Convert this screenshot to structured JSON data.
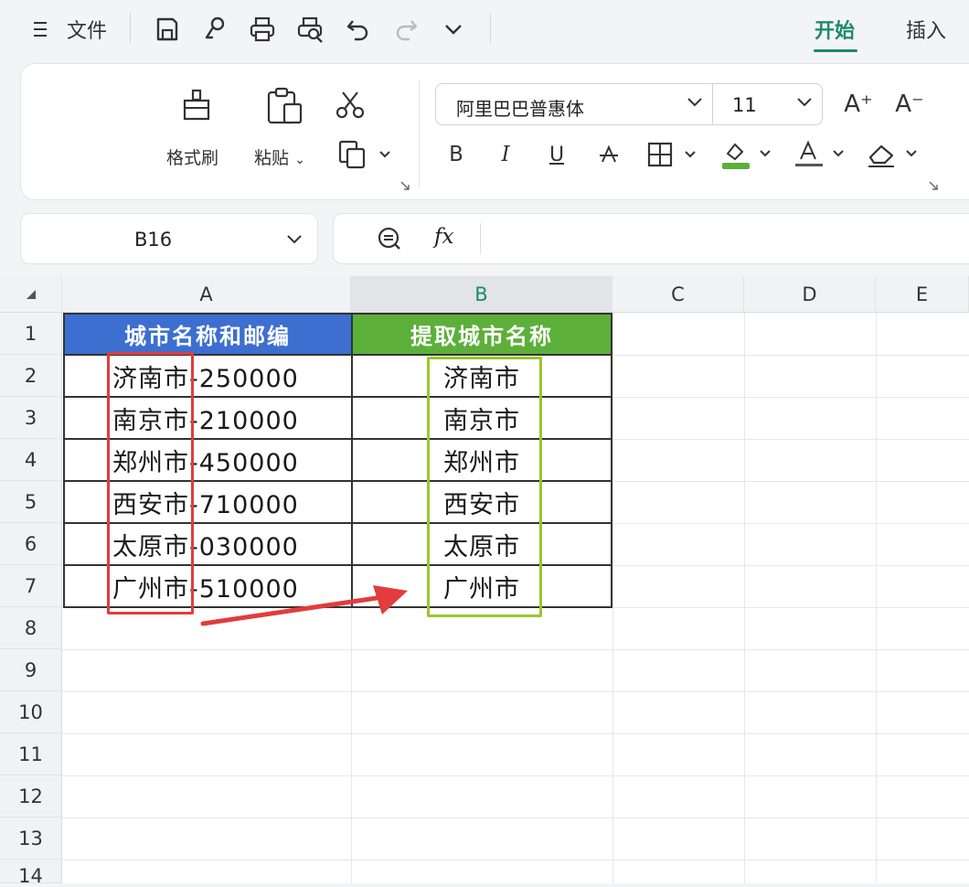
{
  "topbar": {
    "menu_icon": "hamburger-icon",
    "file_label": "文件",
    "tabs": [
      {
        "label": "开始",
        "active": true
      },
      {
        "label": "插入",
        "active": false
      }
    ]
  },
  "ribbon": {
    "format_painter_label": "格式刷",
    "paste_label": "粘贴",
    "font_name": "阿里巴巴普惠体",
    "font_size": "11",
    "bold": "B",
    "italic": "I",
    "underline": "U",
    "font_color_letter": "A",
    "increase_font": "A⁺",
    "decrease_font": "A⁻"
  },
  "formula_bar": {
    "cell_ref": "B16",
    "fx_label": "fx",
    "value": ""
  },
  "sheet": {
    "columns": [
      "A",
      "B",
      "C",
      "D",
      "E"
    ],
    "rows": [
      "1",
      "2",
      "3",
      "4",
      "5",
      "6",
      "7",
      "8",
      "9",
      "10",
      "11",
      "12",
      "13",
      "14"
    ],
    "headers": {
      "a": "城市名称和邮编",
      "b": "提取城市名称"
    },
    "data": [
      {
        "a": "济南市-250000",
        "b": "济南市"
      },
      {
        "a": "南京市-210000",
        "b": "南京市"
      },
      {
        "a": "郑州市-450000",
        "b": "郑州市"
      },
      {
        "a": "西安市-710000",
        "b": "西安市"
      },
      {
        "a": "太原市-030000",
        "b": "太原市"
      },
      {
        "a": "广州市-510000",
        "b": "广州市"
      }
    ]
  },
  "colors": {
    "header_a": "#3d6fd0",
    "header_b": "#5cb03a",
    "highlight_red": "#e23c3c",
    "highlight_green": "#9cc62a",
    "active_tab": "#1e8a6a"
  }
}
